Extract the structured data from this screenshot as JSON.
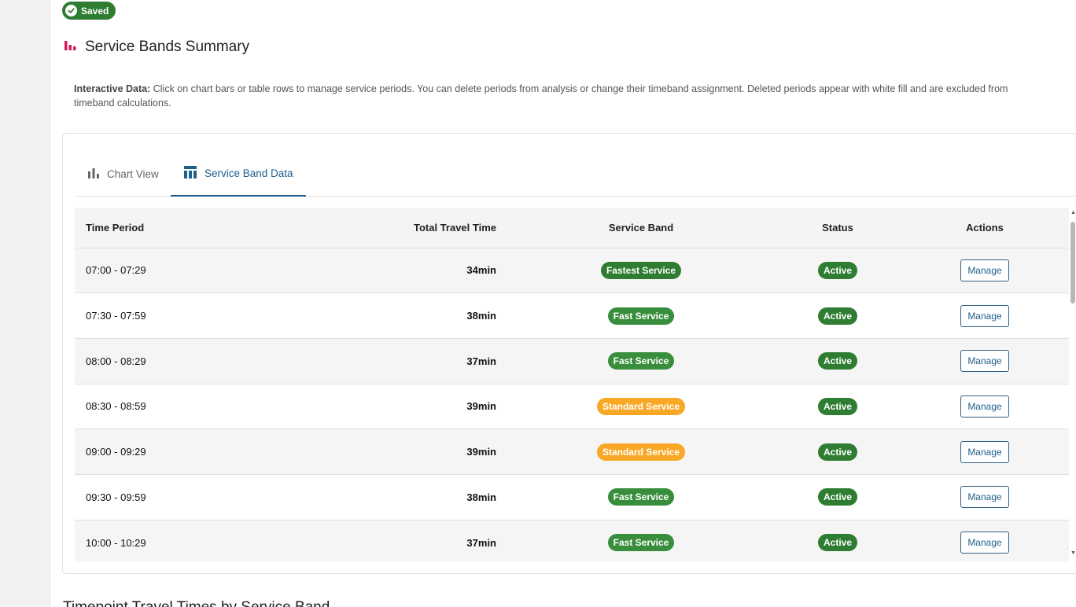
{
  "saved_chip": {
    "label": "Saved",
    "icon": "check-circle-icon"
  },
  "section": {
    "title": "Service Bands Summary",
    "icon": "bar-chart-icon"
  },
  "info": {
    "lead": "Interactive Data:",
    "text": " Click on chart bars or table rows to manage service periods. You can delete periods from analysis or change their timeband assignment. Deleted periods appear with white fill and are excluded from timeband calculations."
  },
  "tabs": [
    {
      "label": "Chart View",
      "icon": "bar-chart-icon",
      "active": false
    },
    {
      "label": "Service Band Data",
      "icon": "table-icon",
      "active": true
    }
  ],
  "table": {
    "headers": [
      "Time Period",
      "Total Travel Time",
      "Service Band",
      "Status",
      "Actions"
    ],
    "rows": [
      {
        "period": "07:00 - 07:29",
        "time": "34min",
        "band": "Fastest Service",
        "status": "Active",
        "action": "Manage"
      },
      {
        "period": "07:30 - 07:59",
        "time": "38min",
        "band": "Fast Service",
        "status": "Active",
        "action": "Manage"
      },
      {
        "period": "08:00 - 08:29",
        "time": "37min",
        "band": "Fast Service",
        "status": "Active",
        "action": "Manage"
      },
      {
        "period": "08:30 - 08:59",
        "time": "39min",
        "band": "Standard Service",
        "status": "Active",
        "action": "Manage"
      },
      {
        "period": "09:00 - 09:29",
        "time": "39min",
        "band": "Standard Service",
        "status": "Active",
        "action": "Manage"
      },
      {
        "period": "09:30 - 09:59",
        "time": "38min",
        "band": "Fast Service",
        "status": "Active",
        "action": "Manage"
      },
      {
        "period": "10:00 - 10:29",
        "time": "37min",
        "band": "Fast Service",
        "status": "Active",
        "action": "Manage"
      }
    ]
  },
  "colors": {
    "Fastest Service": "#2e7d32",
    "Fast Service": "#388e3c",
    "Standard Service": "#f9a825",
    "Active": "#2e7d32",
    "accent": "#1f5f8b",
    "title_icon": "#d81b60"
  },
  "next_section": {
    "title": "Timepoint Travel Times by Service Band"
  }
}
